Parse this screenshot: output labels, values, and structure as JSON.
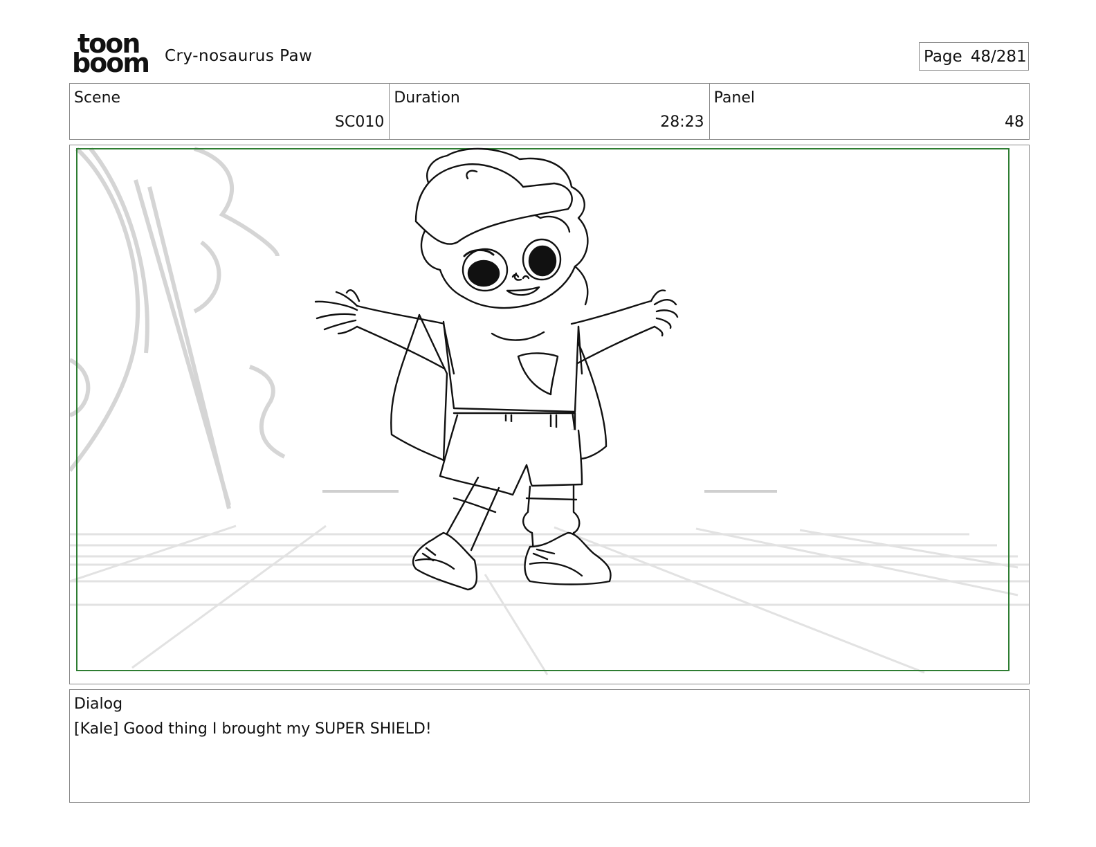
{
  "header": {
    "logo": {
      "line1": "toon",
      "line2": "boom"
    },
    "project_title": "Cry-nosaurus Paw",
    "page": {
      "label": "Page",
      "value": "48/281"
    }
  },
  "info": {
    "scene": {
      "label": "Scene",
      "value": "SC010"
    },
    "duration": {
      "label": "Duration",
      "value": "28:23"
    },
    "panel": {
      "label": "Panel",
      "value": "48"
    }
  },
  "panel_image": {
    "safe_frame_color": "#2e7d32",
    "content_icon": "storyboard-sketch-kid-with-cape"
  },
  "dialog": {
    "label": "Dialog",
    "text": "[Kale] Good thing I brought my SUPER SHIELD!"
  }
}
